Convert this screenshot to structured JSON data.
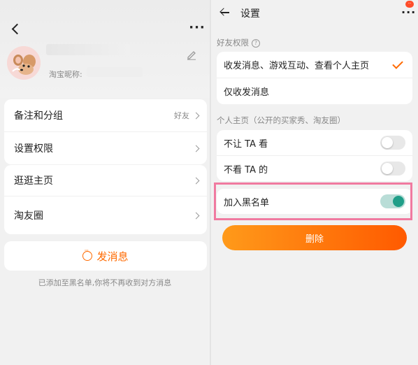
{
  "left": {
    "nickname_label": "淘宝昵称:",
    "groups": [
      [
        {
          "label": "备注和分组",
          "meta": "好友"
        },
        {
          "label": "设置权限",
          "meta": ""
        }
      ],
      [
        {
          "label": "逛逛主页",
          "meta": ""
        },
        {
          "label": "淘友圈",
          "meta": ""
        }
      ]
    ],
    "send_message": "发消息",
    "blacklist_note": "已添加至黑名单,你将不再收到对方消息"
  },
  "right": {
    "title": "设置",
    "notification_count": "··",
    "friend_permission_title": "好友权限",
    "permission_options": [
      {
        "label": "收发消息、游戏互动、查看个人主页",
        "selected": true
      },
      {
        "label": "仅收发消息",
        "selected": false
      }
    ],
    "homepage_title": "个人主页（公开的买家秀、淘友圈）",
    "homepage_toggles": [
      {
        "label": "不让 TA 看",
        "on": false
      },
      {
        "label": "不看 TA 的",
        "on": false
      }
    ],
    "blacklist_toggle": {
      "label": "加入黑名单",
      "on": true
    },
    "delete_label": "删除"
  },
  "colors": {
    "accent": "#ff6a00",
    "toggle_on": "#1f9e88",
    "highlight_border": "#f07aa0"
  }
}
